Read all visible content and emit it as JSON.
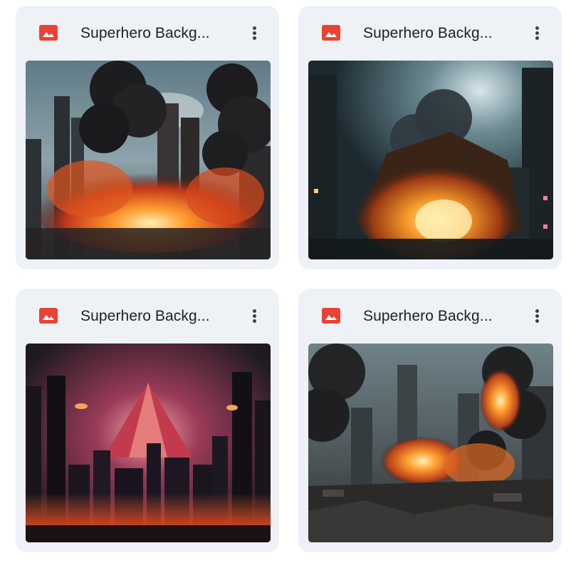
{
  "files": [
    {
      "name": "Superhero Backg...",
      "icon": "image-file-icon",
      "menu_icon": "more-vert-icon",
      "thumbnail": "city-explosion-smoke-thumbnail"
    },
    {
      "name": "Superhero Backg...",
      "icon": "image-file-icon",
      "menu_icon": "more-vert-icon",
      "thumbnail": "building-fireball-night-thumbnail"
    },
    {
      "name": "Superhero Backg...",
      "icon": "image-file-icon",
      "menu_icon": "more-vert-icon",
      "thumbnail": "red-pyramid-city-thumbnail"
    },
    {
      "name": "Superhero Backg...",
      "icon": "image-file-icon",
      "menu_icon": "more-vert-icon",
      "thumbnail": "ruined-street-fire-thumbnail"
    }
  ],
  "colors": {
    "card_background": "#eef1f6",
    "image_icon": "#ea4335",
    "title_text": "#202124"
  }
}
